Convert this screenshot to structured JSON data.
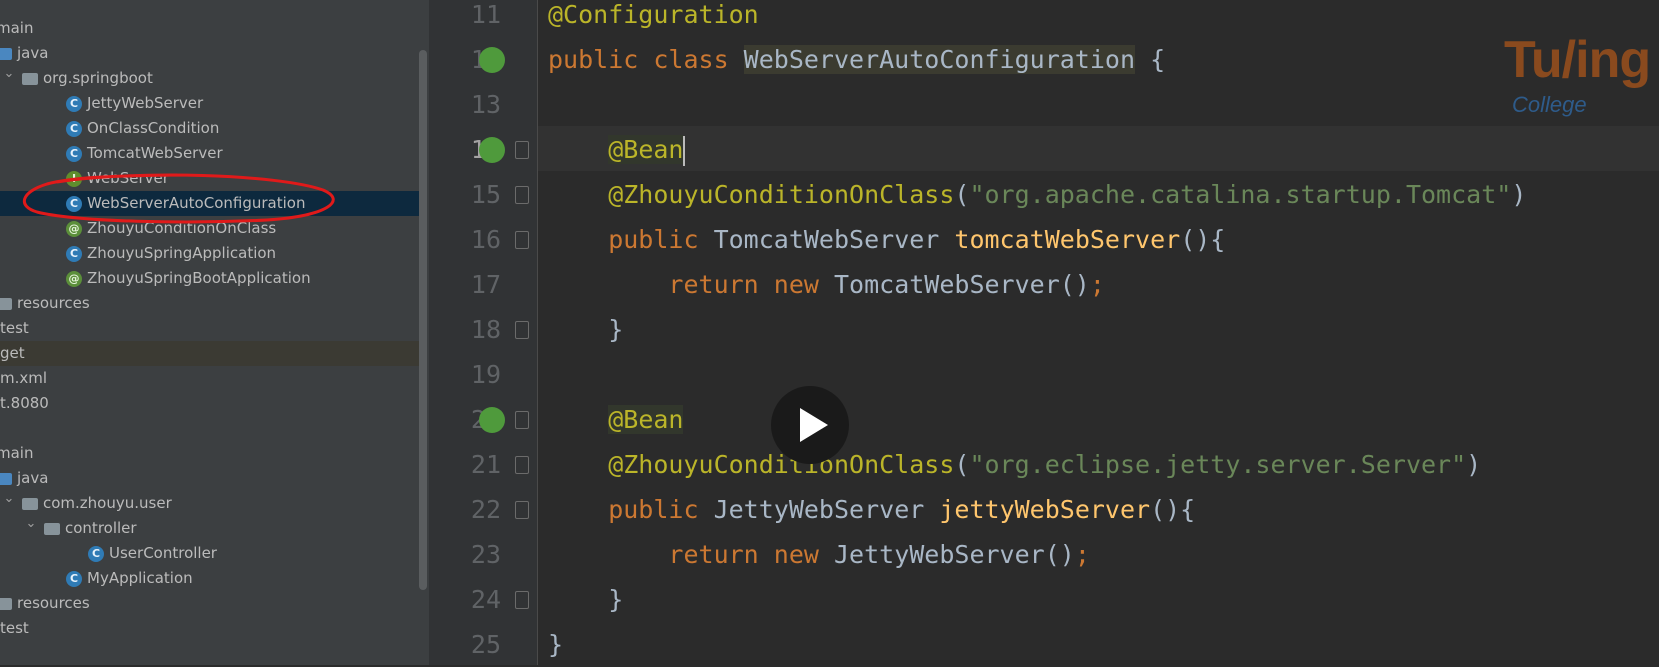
{
  "project_tree": {
    "items": [
      {
        "label": "main",
        "icon": "folder-icon",
        "level": 0,
        "chevron": "",
        "state": ""
      },
      {
        "label": "java",
        "icon": "source-folder-icon",
        "level": 0,
        "chevron": "",
        "state": ""
      },
      {
        "label": "org.springboot",
        "icon": "package-icon",
        "level": 1,
        "chevron": "expanded",
        "state": ""
      },
      {
        "label": "JettyWebServer",
        "icon": "class-icon",
        "level": 2,
        "chevron": "",
        "state": ""
      },
      {
        "label": "OnClassCondition",
        "icon": "class-icon",
        "level": 2,
        "chevron": "",
        "state": ""
      },
      {
        "label": "TomcatWebServer",
        "icon": "class-icon",
        "level": 2,
        "chevron": "",
        "state": ""
      },
      {
        "label": "WebServer",
        "icon": "interface-icon",
        "level": 2,
        "chevron": "",
        "state": ""
      },
      {
        "label": "WebServerAutoConfiguration",
        "icon": "class-icon",
        "level": 2,
        "chevron": "",
        "state": "selected"
      },
      {
        "label": "ZhouyuConditionOnClass",
        "icon": "annotation-icon",
        "level": 2,
        "chevron": "",
        "state": ""
      },
      {
        "label": "ZhouyuSpringApplication",
        "icon": "class-icon",
        "level": 2,
        "chevron": "",
        "state": ""
      },
      {
        "label": "ZhouyuSpringBootApplication",
        "icon": "annotation-icon",
        "level": 2,
        "chevron": "",
        "state": ""
      },
      {
        "label": "resources",
        "icon": "resources-folder-icon",
        "level": 0,
        "chevron": "",
        "state": ""
      },
      {
        "label": "test",
        "icon": "",
        "level": -1,
        "chevron": "",
        "state": ""
      },
      {
        "label": "get",
        "icon": "",
        "level": -1,
        "chevron": "",
        "state": "highlighted"
      },
      {
        "label": "m.xml",
        "icon": "",
        "level": -1,
        "chevron": "",
        "state": ""
      },
      {
        "label": "t.8080",
        "icon": "",
        "level": -1,
        "chevron": "",
        "state": ""
      },
      {
        "label": "",
        "icon": "",
        "level": -1,
        "chevron": "",
        "state": ""
      },
      {
        "label": "main",
        "icon": "folder-icon",
        "level": 0,
        "chevron": "",
        "state": ""
      },
      {
        "label": "java",
        "icon": "source-folder-icon",
        "level": 0,
        "chevron": "",
        "state": ""
      },
      {
        "label": "com.zhouyu.user",
        "icon": "package-icon",
        "level": 1,
        "chevron": "expanded",
        "state": ""
      },
      {
        "label": "controller",
        "icon": "package-icon",
        "level": 2,
        "chevron": "expanded",
        "state": ""
      },
      {
        "label": "UserController",
        "icon": "class-icon",
        "level": 3,
        "chevron": "",
        "state": ""
      },
      {
        "label": "MyApplication",
        "icon": "spring-class-icon",
        "level": 2,
        "chevron": "",
        "state": ""
      },
      {
        "label": "resources",
        "icon": "resources-folder-icon",
        "level": 0,
        "chevron": "",
        "state": ""
      },
      {
        "label": "test",
        "icon": "",
        "level": -1,
        "chevron": "",
        "state": ""
      }
    ]
  },
  "editor": {
    "line_numbers": [
      "11",
      "12",
      "13",
      "14",
      "15",
      "16",
      "17",
      "18",
      "19",
      "20",
      "21",
      "22",
      "23",
      "24",
      "25"
    ],
    "current_line": "14",
    "lines": [
      [
        {
          "t": "@Configuration",
          "c": "ann"
        }
      ],
      [
        {
          "t": "public class ",
          "c": "kw"
        },
        {
          "t": "WebServerAutoConfiguration",
          "c": "plain cls-hl"
        },
        {
          "t": " {",
          "c": "plain"
        }
      ],
      [],
      [
        {
          "t": "    ",
          "c": "plain"
        },
        {
          "t": "@Bean",
          "c": "ann bean-bg"
        },
        {
          "t": "",
          "c": "caret"
        }
      ],
      [
        {
          "t": "    @ZhouyuConditionOnClass",
          "c": "ann"
        },
        {
          "t": "(",
          "c": "plain"
        },
        {
          "t": "\"org.apache.catalina.startup.Tomcat\"",
          "c": "str"
        },
        {
          "t": ")",
          "c": "plain"
        }
      ],
      [
        {
          "t": "    public ",
          "c": "kw"
        },
        {
          "t": "TomcatWebServer ",
          "c": "plain"
        },
        {
          "t": "tomcatWebServer",
          "c": "fn"
        },
        {
          "t": "(){",
          "c": "plain"
        }
      ],
      [
        {
          "t": "        return new ",
          "c": "kw"
        },
        {
          "t": "TomcatWebServer()",
          "c": "plain"
        },
        {
          "t": ";",
          "c": "kw"
        }
      ],
      [
        {
          "t": "    }",
          "c": "plain"
        }
      ],
      [],
      [
        {
          "t": "    ",
          "c": "plain"
        },
        {
          "t": "@Bean",
          "c": "ann bean-bg"
        }
      ],
      [
        {
          "t": "    @ZhouyuConditionOnClass",
          "c": "ann"
        },
        {
          "t": "(",
          "c": "plain"
        },
        {
          "t": "\"org.eclipse.jetty.server.Server\"",
          "c": "str"
        },
        {
          "t": ")",
          "c": "plain"
        }
      ],
      [
        {
          "t": "    public ",
          "c": "kw"
        },
        {
          "t": "JettyWebServer ",
          "c": "plain"
        },
        {
          "t": "jettyWebServer",
          "c": "fn"
        },
        {
          "t": "(){",
          "c": "plain"
        }
      ],
      [
        {
          "t": "        return new ",
          "c": "kw"
        },
        {
          "t": "JettyWebServer()",
          "c": "plain"
        },
        {
          "t": ";",
          "c": "kw"
        }
      ],
      [
        {
          "t": "    }",
          "c": "plain"
        }
      ],
      [
        {
          "t": "}",
          "c": "plain"
        }
      ]
    ],
    "gutter_icons": [
      {
        "line": "12",
        "icon": "spring-bean-config-icon"
      },
      {
        "line": "14",
        "icon": "spring-bean-method-icon"
      },
      {
        "line": "20",
        "icon": "spring-bean-method-icon"
      }
    ],
    "fold_markers": [
      "14",
      "15",
      "16",
      "18",
      "20",
      "21",
      "22",
      "24"
    ]
  },
  "overlay": {
    "play_button": "play-icon",
    "watermark": {
      "brand": "Tu/ing",
      "sub": "College"
    },
    "annotation": "red-circle-annotation"
  },
  "colors": {
    "keyword": "#cc7832",
    "annotation": "#bbb529",
    "string": "#6a8759",
    "method": "#ffc66d",
    "plain": "#a9b7c6",
    "selection": "#0d293e",
    "red_marker": "#e01a1a"
  }
}
